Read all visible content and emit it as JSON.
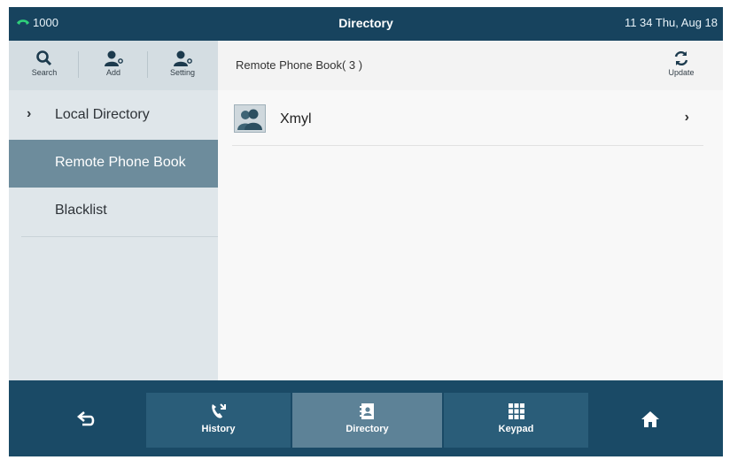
{
  "status_bar": {
    "line": "1000",
    "title": "Directory",
    "clock": "11 34 Thu, Aug 18",
    "line_icon": "phone-handset-icon",
    "line_icon_color": "#2fd07a"
  },
  "toolbar": {
    "search": "Search",
    "add": "Add",
    "setting": "Setting"
  },
  "menu": {
    "items": [
      {
        "label": "Local Directory",
        "has_chevron": true,
        "active": false
      },
      {
        "label": "Remote Phone Book",
        "has_chevron": false,
        "active": true
      },
      {
        "label": "Blacklist",
        "has_chevron": false,
        "active": false
      }
    ],
    "chevron": "›"
  },
  "content": {
    "header": "Remote Phone Book( 3 )",
    "update": "Update",
    "contacts": [
      {
        "name": "Xmyl"
      }
    ],
    "row_chevron": "›"
  },
  "bottom_nav": {
    "history": "History",
    "directory": "Directory",
    "keypad": "Keypad",
    "active": "Directory"
  },
  "colors": {
    "frame": "#1a4a66",
    "active_menu": "#6d8c9c",
    "active_nav": "#5d8297"
  }
}
